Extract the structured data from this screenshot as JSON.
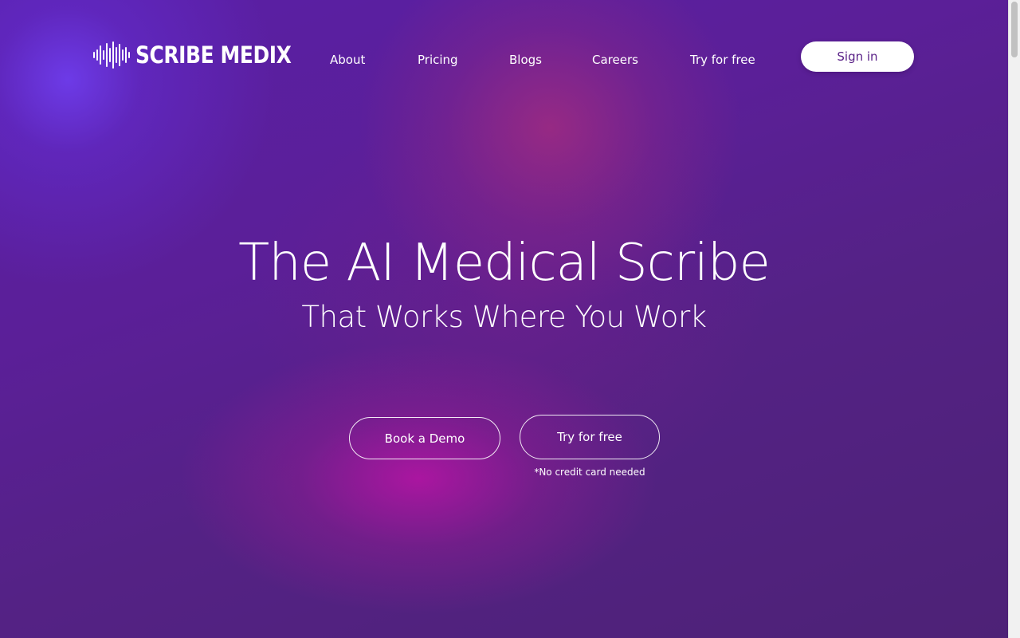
{
  "brand": {
    "name": "SCRIBE MEDIX",
    "logo_icon": "soundwave-icon"
  },
  "nav": {
    "items": [
      {
        "label": "About"
      },
      {
        "label": "Pricing"
      },
      {
        "label": "Blogs"
      },
      {
        "label": "Careers"
      },
      {
        "label": "Try for free"
      }
    ],
    "sign_in_label": "Sign in"
  },
  "hero": {
    "title": "The AI Medical Scribe",
    "subtitle": "That Works Where You Work",
    "demo_button_label": "Book a Demo",
    "try_button_label": "Try for free",
    "try_note": "*No credit card needed"
  },
  "colors": {
    "background": "#5a1fa6",
    "accent_pink": "#b0149f",
    "signin_text": "#5a2187",
    "text": "#ffffff"
  }
}
